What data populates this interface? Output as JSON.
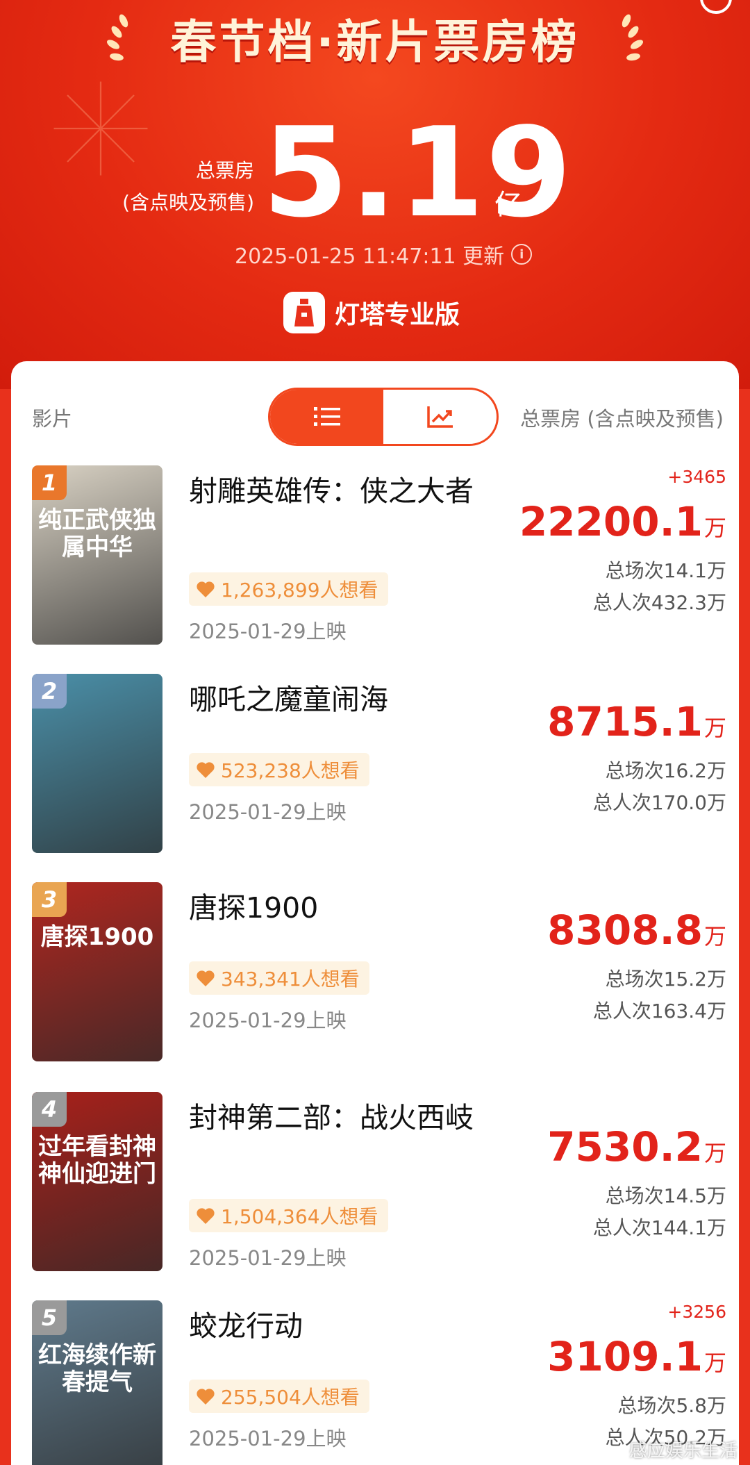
{
  "header": {
    "title": "春节档·新片票房榜",
    "total_label_line1": "总票房",
    "total_label_line2": "(含点映及预售)",
    "total_value": "5.19",
    "total_unit": "亿",
    "update_text": "2025-01-25 11:47:11 更新",
    "brand": "灯塔专业版"
  },
  "table": {
    "col_film": "影片",
    "col_total": "总票房 (含点映及预售)"
  },
  "movies": [
    {
      "rank": "1",
      "title": "射雕英雄传：侠之大者",
      "want": "1,263,899人想看",
      "release": "2025-01-29上映",
      "delta": "+3465",
      "box": "22200.1",
      "unit": "万",
      "shows": "总场次14.1万",
      "admissions": "总人次432.3万",
      "poster_text": "纯正武侠独属中华",
      "poster_color": "#d9d2c4"
    },
    {
      "rank": "2",
      "title": "哪吒之魔童闹海",
      "want": "523,238人想看",
      "release": "2025-01-29上映",
      "delta": "",
      "box": "8715.1",
      "unit": "万",
      "shows": "总场次16.2万",
      "admissions": "总人次170.0万",
      "poster_text": "",
      "poster_color": "#4a8fa8"
    },
    {
      "rank": "3",
      "title": "唐探1900",
      "want": "343,341人想看",
      "release": "2025-01-29上映",
      "delta": "",
      "box": "8308.8",
      "unit": "万",
      "shows": "总场次15.2万",
      "admissions": "总人次163.4万",
      "poster_text": "唐探1900",
      "poster_color": "#b0261f"
    },
    {
      "rank": "4",
      "title": "封神第二部：战火西岐",
      "want": "1,504,364人想看",
      "release": "2025-01-29上映",
      "delta": "",
      "box": "7530.2",
      "unit": "万",
      "shows": "总场次14.5万",
      "admissions": "总人次144.1万",
      "poster_text": "过年看封神神仙迎进门",
      "poster_color": "#a8201a"
    },
    {
      "rank": "5",
      "title": "蛟龙行动",
      "want": "255,504人想看",
      "release": "2025-01-29上映",
      "delta": "+3256",
      "box": "3109.1",
      "unit": "万",
      "shows": "总场次5.8万",
      "admissions": "总人次50.2万",
      "poster_text": "红海续作新春提气",
      "poster_color": "#5f7a8c"
    }
  ],
  "watermark": "感应娱乐生活",
  "colors": {
    "accent": "#f2471e",
    "box_red": "#e2231a",
    "want_orange": "#ee8e3a",
    "rank1": "#e9772b",
    "rank2": "#8aa3c9",
    "rank3": "#e9a552",
    "rank_other": "#9a9a9a"
  }
}
